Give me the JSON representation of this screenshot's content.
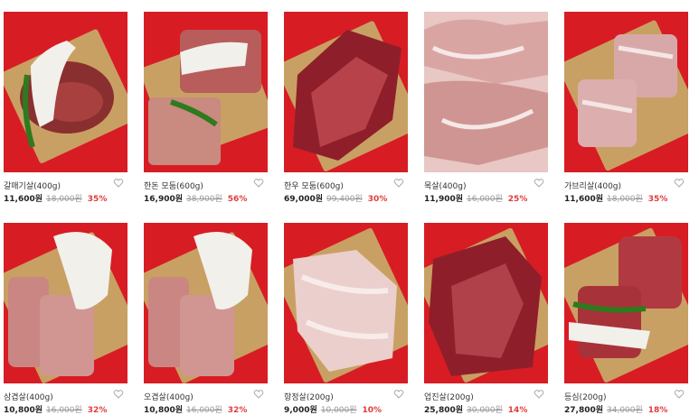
{
  "products": [
    {
      "name": "갈매기살(400g)",
      "price": "11,600원",
      "original": "18,000원",
      "discount": "35%",
      "meat": "dark"
    },
    {
      "name": "한돈 모둠(600g)",
      "price": "16,900원",
      "original": "38,900원",
      "discount": "56%",
      "meat": "pork"
    },
    {
      "name": "한우 모둠(600g)",
      "price": "69,000원",
      "original": "99,400원",
      "discount": "30%",
      "meat": "beef"
    },
    {
      "name": "목살(400g)",
      "price": "11,900원",
      "original": "16,000원",
      "discount": "25%",
      "meat": "marbled"
    },
    {
      "name": "가브리살(400g)",
      "price": "11,600원",
      "original": "18,000원",
      "discount": "35%",
      "meat": "pork"
    },
    {
      "name": "삼겹살(400g)",
      "price": "10,800원",
      "original": "16,000원",
      "discount": "32%",
      "meat": "pork"
    },
    {
      "name": "오겹살(400g)",
      "price": "10,800원",
      "original": "16,000원",
      "discount": "32%",
      "meat": "pork"
    },
    {
      "name": "항정살(200g)",
      "price": "9,000원",
      "original": "10,000원",
      "discount": "10%",
      "meat": "pale"
    },
    {
      "name": "업진살(200g)",
      "price": "25,800원",
      "original": "30,000원",
      "discount": "14%",
      "meat": "beef"
    },
    {
      "name": "등심(200g)",
      "price": "27,800원",
      "original": "34,000원",
      "discount": "18%",
      "meat": "beef"
    }
  ],
  "colors": {
    "background_red": "#d81c24",
    "board": "#c9a063",
    "discount": "#e23b3b"
  }
}
